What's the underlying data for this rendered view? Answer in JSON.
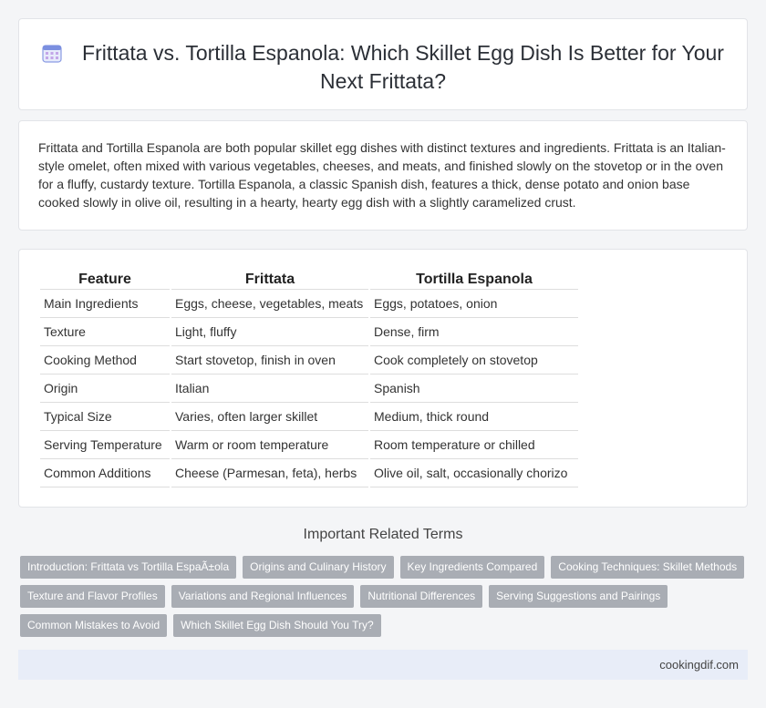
{
  "header": {
    "title": "Frittata vs. Tortilla Espanola: Which Skillet Egg Dish Is Better for Your Next Frittata?",
    "icon": "calendar-icon"
  },
  "intro": {
    "text": "Frittata and Tortilla Espanola are both popular skillet egg dishes with distinct textures and ingredients. Frittata is an Italian-style omelet, often mixed with various vegetables, cheeses, and meats, and finished slowly on the stovetop or in the oven for a fluffy, custardy texture. Tortilla Espanola, a classic Spanish dish, features a thick, dense potato and onion base cooked slowly in olive oil, resulting in a hearty, hearty egg dish with a slightly caramelized crust."
  },
  "table": {
    "headers": [
      "Feature",
      "Frittata",
      "Tortilla Espanola"
    ],
    "rows": [
      [
        "Main Ingredients",
        "Eggs, cheese, vegetables, meats",
        "Eggs, potatoes, onion"
      ],
      [
        "Texture",
        "Light, fluffy",
        "Dense, firm"
      ],
      [
        "Cooking Method",
        "Start stovetop, finish in oven",
        "Cook completely on stovetop"
      ],
      [
        "Origin",
        "Italian",
        "Spanish"
      ],
      [
        "Typical Size",
        "Varies, often larger skillet",
        "Medium, thick round"
      ],
      [
        "Serving Temperature",
        "Warm or room temperature",
        "Room temperature or chilled"
      ],
      [
        "Common Additions",
        "Cheese (Parmesan, feta), herbs",
        "Olive oil, salt, occasionally chorizo"
      ]
    ]
  },
  "related": {
    "heading": "Important Related Terms",
    "rows": [
      [
        "Introduction: Frittata vs Tortilla EspaÃ±ola",
        "Origins and Culinary History",
        "Key Ingredients Compared",
        "Cooking Techniques: Skillet Methods"
      ],
      [
        "Texture and Flavor Profiles",
        "Variations and Regional Influences",
        "Nutritional Differences",
        "Serving Suggestions and Pairings"
      ],
      [
        "Common Mistakes to Avoid",
        "Which Skillet Egg Dish Should You Try?"
      ]
    ]
  },
  "footer": {
    "site": "cookingdif.com"
  },
  "colors": {
    "tag_bg": "#a9adb4",
    "footer_bg": "#e8edf8",
    "icon_accent": "#6c7fd8"
  }
}
